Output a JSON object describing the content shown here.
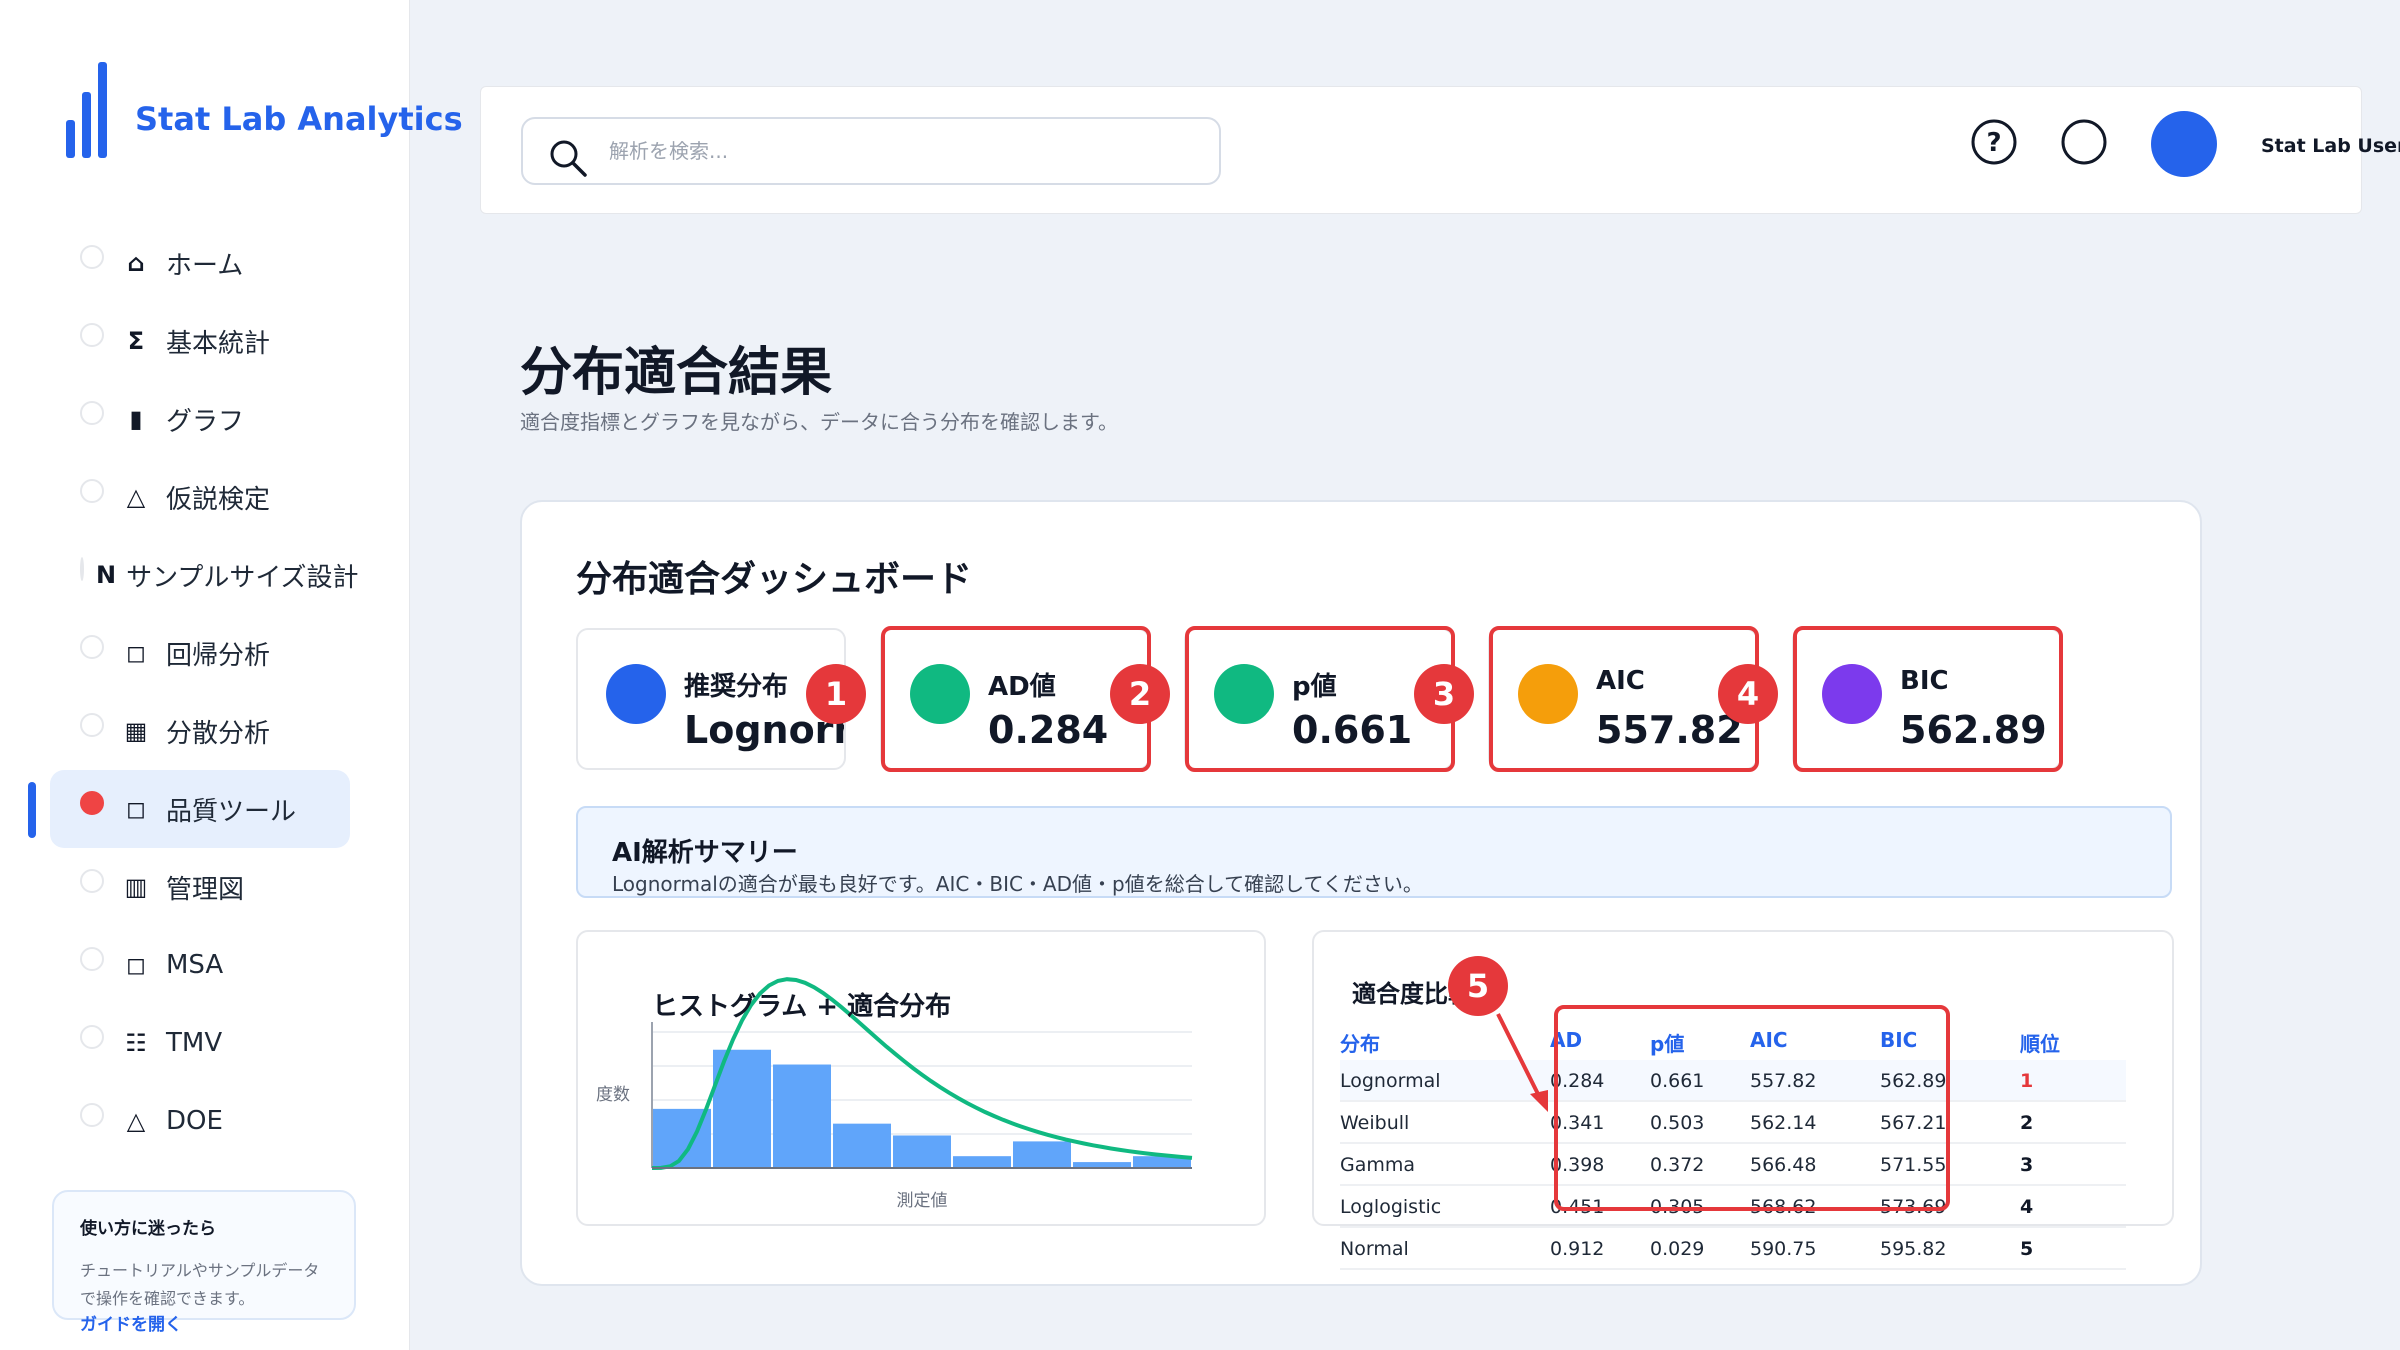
{
  "app": {
    "name": "Stat Lab Analytics",
    "user_name": "Stat Lab User",
    "accent": "#2563eb",
    "highlight": "#e5383b"
  },
  "sidebar": {
    "items": [
      {
        "label": "ホーム",
        "icon": "⌂",
        "icon_name": "home-icon"
      },
      {
        "label": "基本統計",
        "icon": "Σ",
        "icon_name": "sigma-icon"
      },
      {
        "label": "グラフ",
        "icon": "▮",
        "icon_name": "bar-icon"
      },
      {
        "label": "仮説検定",
        "icon": "△",
        "icon_name": "triangle-icon"
      },
      {
        "label": "サンプルサイズ設計",
        "icon": "N",
        "icon_name": "n-icon"
      },
      {
        "label": "回帰分析",
        "icon": "◻",
        "icon_name": "square-icon"
      },
      {
        "label": "分散分析",
        "icon": "▦",
        "icon_name": "grid-icon"
      },
      {
        "label": "品質ツール",
        "icon": "◻",
        "icon_name": "square-icon",
        "active": true
      },
      {
        "label": "管理図",
        "icon": "▥",
        "icon_name": "control-chart-icon"
      },
      {
        "label": "MSA",
        "icon": "◻",
        "icon_name": "square-icon"
      },
      {
        "label": "TMV",
        "icon": "☷",
        "icon_name": "list-icon"
      },
      {
        "label": "DOE",
        "icon": "△",
        "icon_name": "triangle-icon"
      }
    ],
    "help": {
      "title": "使い方に迷ったら",
      "body": "チュートリアルやサンプルデータで操作を確認できます。",
      "link": "ガイドを開く"
    }
  },
  "topbar": {
    "search_placeholder": "解析を検索...",
    "help_icon": "?"
  },
  "page": {
    "title": "分布適合結果",
    "subtitle": "適合度指標とグラフを見ながら、データに合う分布を確認します。"
  },
  "dashboard": {
    "title": "分布適合ダッシュボード",
    "metrics": [
      {
        "label": "推奨分布",
        "value": "Lognormal",
        "color": "#2563eb",
        "badge": "1"
      },
      {
        "label": "AD値",
        "value": "0.284",
        "color": "#10b981",
        "badge": "2"
      },
      {
        "label": "p値",
        "value": "0.661",
        "color": "#10b981",
        "badge": "3"
      },
      {
        "label": "AIC",
        "value": "557.82",
        "color": "#f59e0b",
        "badge": "4"
      },
      {
        "label": "BIC",
        "value": "562.89",
        "color": "#7c3aed",
        "badge": ""
      }
    ],
    "ai_summary": {
      "title": "AI解析サマリー",
      "body": "Lognormalの適合が最も良好です。AIC・BIC・AD値・p値を総合して確認してください。"
    },
    "table_badge": "5"
  },
  "chart_data": {
    "type": "bar",
    "title": "ヒストグラム + 適合分布",
    "xlabel": "測定値",
    "ylabel": "度数",
    "values": [
      10,
      20,
      17.5,
      7.5,
      5.5,
      2,
      4.5,
      1,
      2
    ],
    "ylim": [
      0,
      23
    ],
    "fit_curve": {
      "type": "line",
      "color": "#10b981"
    },
    "grid": true,
    "bar_color": "#60a5fa"
  },
  "fit_table": {
    "title": "適合度比較",
    "columns": [
      "分布",
      "AD",
      "p値",
      "AIC",
      "BIC",
      "順位"
    ],
    "rows": [
      [
        "Lognormal",
        "0.284",
        "0.661",
        "557.82",
        "562.89",
        "1"
      ],
      [
        "Weibull",
        "0.341",
        "0.503",
        "562.14",
        "567.21",
        "2"
      ],
      [
        "Gamma",
        "0.398",
        "0.372",
        "566.48",
        "571.55",
        "3"
      ],
      [
        "Loglogistic",
        "0.451",
        "0.305",
        "568.62",
        "573.69",
        "4"
      ],
      [
        "Normal",
        "0.912",
        "0.029",
        "590.75",
        "595.82",
        "5"
      ]
    ]
  }
}
